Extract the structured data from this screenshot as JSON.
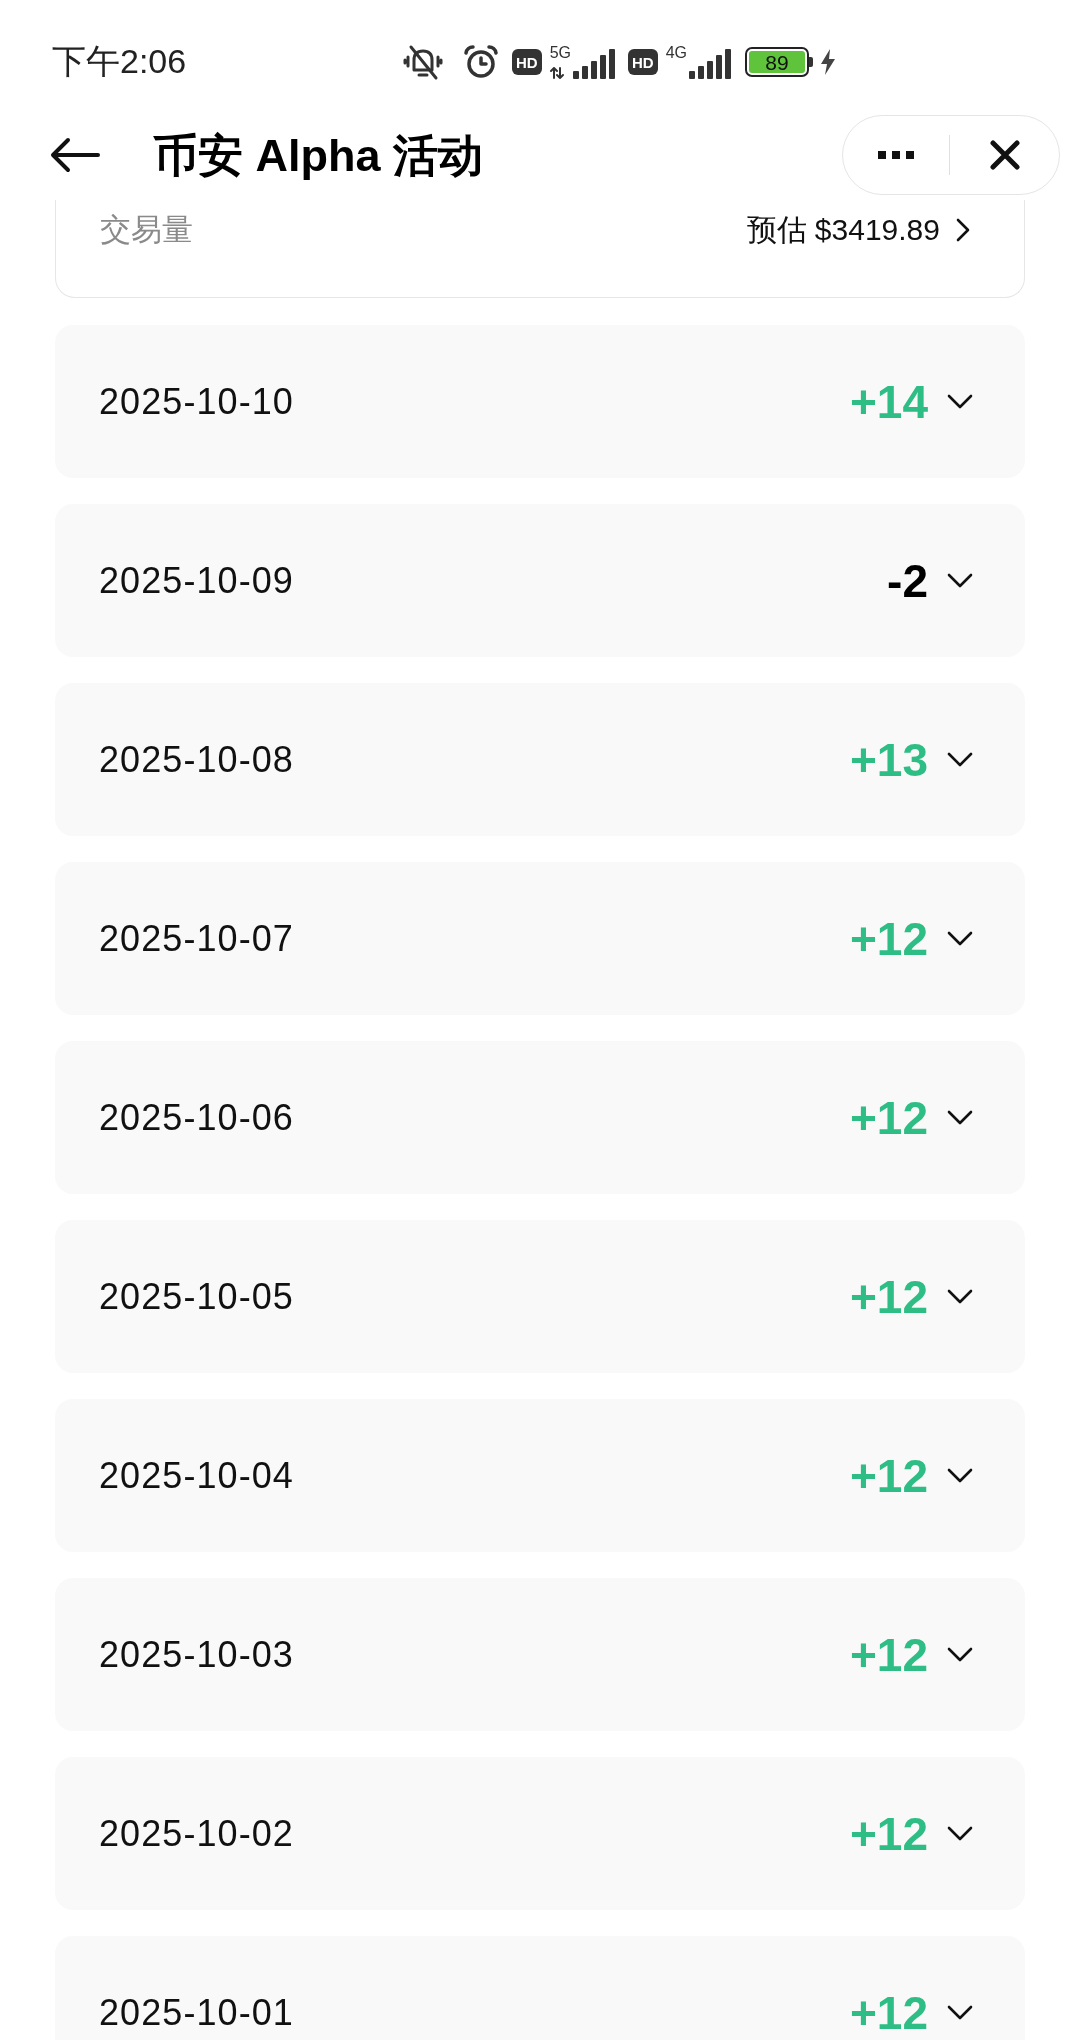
{
  "status_bar": {
    "time": "下午2:06",
    "sim_slots": [
      {
        "badge": "HD",
        "network": "5G"
      },
      {
        "badge": "HD",
        "network": "4G"
      }
    ],
    "battery": "89"
  },
  "header": {
    "title": "币安 Alpha 活动"
  },
  "summary": {
    "label": "交易量",
    "value": "预估 $3419.89"
  },
  "days": [
    {
      "date": "2025-10-10",
      "change": "+14",
      "color": "#2ebd85",
      "expanded": false
    },
    {
      "date": "2025-10-09",
      "change": "-2",
      "color": "#000000",
      "expanded": false
    },
    {
      "date": "2025-10-08",
      "change": "+13",
      "color": "#2ebd85",
      "expanded": false
    },
    {
      "date": "2025-10-07",
      "change": "+12",
      "color": "#2ebd85",
      "expanded": false
    },
    {
      "date": "2025-10-06",
      "change": "+12",
      "color": "#2ebd85",
      "expanded": false
    },
    {
      "date": "2025-10-05",
      "change": "+12",
      "color": "#2ebd85",
      "expanded": false
    },
    {
      "date": "2025-10-04",
      "change": "+12",
      "color": "#2ebd85",
      "expanded": false
    },
    {
      "date": "2025-10-03",
      "change": "+12",
      "color": "#2ebd85",
      "expanded": false
    },
    {
      "date": "2025-10-02",
      "change": "+12",
      "color": "#2ebd85",
      "expanded": false
    },
    {
      "date": "2025-10-01",
      "change": "+12",
      "color": "#2ebd85",
      "expanded": false
    }
  ]
}
